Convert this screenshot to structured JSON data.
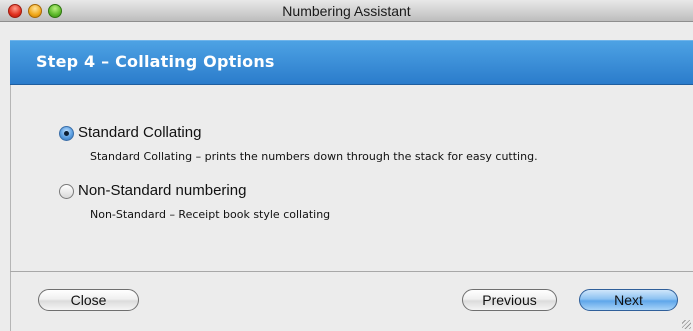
{
  "window": {
    "title": "Numbering Assistant"
  },
  "header": {
    "step_title": "Step 4 – Collating Options"
  },
  "options": [
    {
      "label": "Standard Collating",
      "description": "Standard Collating – prints the numbers down through the stack for easy cutting.",
      "selected": true
    },
    {
      "label": "Non-Standard numbering",
      "description": "Non-Standard – Receipt book style collating",
      "selected": false
    }
  ],
  "buttons": {
    "close": "Close",
    "previous": "Previous",
    "next": "Next"
  },
  "colors": {
    "header_blue": "#3a8fd8",
    "window_bg": "#ececec"
  }
}
